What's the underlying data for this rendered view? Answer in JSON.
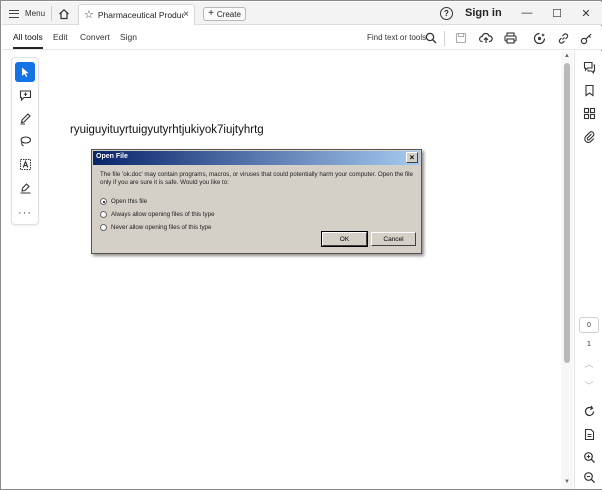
{
  "titlebar": {
    "menu_label": "Menu",
    "tab_title": "Pharmaceutical Product...",
    "tab_close": "×",
    "create_label": "Create",
    "help": "?",
    "sign_in": "Sign in",
    "window_buttons": {
      "minimize": "—",
      "maximize": "☐",
      "close": "✕"
    }
  },
  "menubar": {
    "items": [
      "All tools",
      "Edit",
      "Convert",
      "Sign"
    ],
    "active": "All tools",
    "search_label": "Find text or tools"
  },
  "left_tools": [
    "select-tool",
    "add-comment-tool",
    "draw-tool",
    "lasso-tool",
    "text-box-tool",
    "fill-sign-tool",
    "more-tools"
  ],
  "document": {
    "text": "ryuiguyituyrtuigyutyrhtjukiyok7iujtyhrtg"
  },
  "right_rail": {
    "current_page": "0",
    "total_pages": "1"
  },
  "dialog": {
    "title": "Open File",
    "close": "×",
    "message": "The file 'ok.doc' may contain programs, macros, or viruses that could potentially harm your computer. Open the file only if you are sure it is safe. Would you like to:",
    "options": [
      {
        "label": "Open this file",
        "selected": true
      },
      {
        "label": "Always allow opening files of this type",
        "selected": false
      },
      {
        "label": "Never allow opening files of this type",
        "selected": false
      }
    ],
    "ok_label": "OK",
    "cancel_label": "Cancel"
  },
  "colors": {
    "accent": "#1473e6",
    "dialog_bg": "#d4d0c8",
    "dialog_title_start": "#0a246a",
    "dialog_title_end": "#a6caf0"
  }
}
